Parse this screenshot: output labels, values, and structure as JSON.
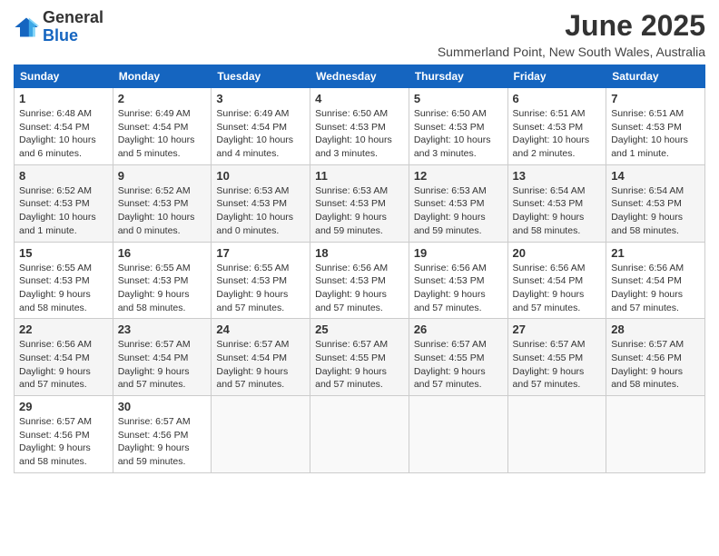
{
  "logo": {
    "general": "General",
    "blue": "Blue"
  },
  "header": {
    "month_title": "June 2025",
    "subtitle": "Summerland Point, New South Wales, Australia"
  },
  "weekdays": [
    "Sunday",
    "Monday",
    "Tuesday",
    "Wednesday",
    "Thursday",
    "Friday",
    "Saturday"
  ],
  "weeks": [
    [
      {
        "day": "1",
        "sunrise": "6:48 AM",
        "sunset": "4:54 PM",
        "daylight": "10 hours and 6 minutes."
      },
      {
        "day": "2",
        "sunrise": "6:49 AM",
        "sunset": "4:54 PM",
        "daylight": "10 hours and 5 minutes."
      },
      {
        "day": "3",
        "sunrise": "6:49 AM",
        "sunset": "4:54 PM",
        "daylight": "10 hours and 4 minutes."
      },
      {
        "day": "4",
        "sunrise": "6:50 AM",
        "sunset": "4:53 PM",
        "daylight": "10 hours and 3 minutes."
      },
      {
        "day": "5",
        "sunrise": "6:50 AM",
        "sunset": "4:53 PM",
        "daylight": "10 hours and 3 minutes."
      },
      {
        "day": "6",
        "sunrise": "6:51 AM",
        "sunset": "4:53 PM",
        "daylight": "10 hours and 2 minutes."
      },
      {
        "day": "7",
        "sunrise": "6:51 AM",
        "sunset": "4:53 PM",
        "daylight": "10 hours and 1 minute."
      }
    ],
    [
      {
        "day": "8",
        "sunrise": "6:52 AM",
        "sunset": "4:53 PM",
        "daylight": "10 hours and 1 minute."
      },
      {
        "day": "9",
        "sunrise": "6:52 AM",
        "sunset": "4:53 PM",
        "daylight": "10 hours and 0 minutes."
      },
      {
        "day": "10",
        "sunrise": "6:53 AM",
        "sunset": "4:53 PM",
        "daylight": "10 hours and 0 minutes."
      },
      {
        "day": "11",
        "sunrise": "6:53 AM",
        "sunset": "4:53 PM",
        "daylight": "9 hours and 59 minutes."
      },
      {
        "day": "12",
        "sunrise": "6:53 AM",
        "sunset": "4:53 PM",
        "daylight": "9 hours and 59 minutes."
      },
      {
        "day": "13",
        "sunrise": "6:54 AM",
        "sunset": "4:53 PM",
        "daylight": "9 hours and 58 minutes."
      },
      {
        "day": "14",
        "sunrise": "6:54 AM",
        "sunset": "4:53 PM",
        "daylight": "9 hours and 58 minutes."
      }
    ],
    [
      {
        "day": "15",
        "sunrise": "6:55 AM",
        "sunset": "4:53 PM",
        "daylight": "9 hours and 58 minutes."
      },
      {
        "day": "16",
        "sunrise": "6:55 AM",
        "sunset": "4:53 PM",
        "daylight": "9 hours and 58 minutes."
      },
      {
        "day": "17",
        "sunrise": "6:55 AM",
        "sunset": "4:53 PM",
        "daylight": "9 hours and 57 minutes."
      },
      {
        "day": "18",
        "sunrise": "6:56 AM",
        "sunset": "4:53 PM",
        "daylight": "9 hours and 57 minutes."
      },
      {
        "day": "19",
        "sunrise": "6:56 AM",
        "sunset": "4:53 PM",
        "daylight": "9 hours and 57 minutes."
      },
      {
        "day": "20",
        "sunrise": "6:56 AM",
        "sunset": "4:54 PM",
        "daylight": "9 hours and 57 minutes."
      },
      {
        "day": "21",
        "sunrise": "6:56 AM",
        "sunset": "4:54 PM",
        "daylight": "9 hours and 57 minutes."
      }
    ],
    [
      {
        "day": "22",
        "sunrise": "6:56 AM",
        "sunset": "4:54 PM",
        "daylight": "9 hours and 57 minutes."
      },
      {
        "day": "23",
        "sunrise": "6:57 AM",
        "sunset": "4:54 PM",
        "daylight": "9 hours and 57 minutes."
      },
      {
        "day": "24",
        "sunrise": "6:57 AM",
        "sunset": "4:54 PM",
        "daylight": "9 hours and 57 minutes."
      },
      {
        "day": "25",
        "sunrise": "6:57 AM",
        "sunset": "4:55 PM",
        "daylight": "9 hours and 57 minutes."
      },
      {
        "day": "26",
        "sunrise": "6:57 AM",
        "sunset": "4:55 PM",
        "daylight": "9 hours and 57 minutes."
      },
      {
        "day": "27",
        "sunrise": "6:57 AM",
        "sunset": "4:55 PM",
        "daylight": "9 hours and 57 minutes."
      },
      {
        "day": "28",
        "sunrise": "6:57 AM",
        "sunset": "4:56 PM",
        "daylight": "9 hours and 58 minutes."
      }
    ],
    [
      {
        "day": "29",
        "sunrise": "6:57 AM",
        "sunset": "4:56 PM",
        "daylight": "9 hours and 58 minutes."
      },
      {
        "day": "30",
        "sunrise": "6:57 AM",
        "sunset": "4:56 PM",
        "daylight": "9 hours and 59 minutes."
      },
      null,
      null,
      null,
      null,
      null
    ]
  ],
  "labels": {
    "sunrise": "Sunrise:",
    "sunset": "Sunset:",
    "daylight": "Daylight:"
  }
}
